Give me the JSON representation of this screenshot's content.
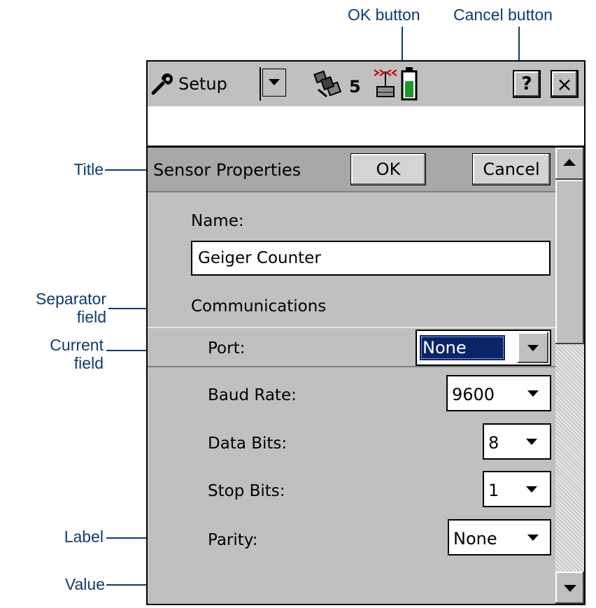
{
  "callouts": {
    "ok_button": "OK button",
    "cancel_button": "Cancel button",
    "title": "Title",
    "separator_field": [
      "Separator",
      "field"
    ],
    "current_field": [
      "Current",
      "field"
    ],
    "label": "Label",
    "value": "Value"
  },
  "topbar": {
    "menu_label": "Setup",
    "satellite_count": "5",
    "help_label": "?",
    "close_label": "×",
    "icons": [
      "wrench-icon",
      "satellite-icon",
      "antenna-icon",
      "battery-icon"
    ]
  },
  "form": {
    "title": "Sensor Properties",
    "ok_label": "OK",
    "cancel_label": "Cancel",
    "name_label": "Name:",
    "name_value": "Geiger Counter",
    "separator": "Communications",
    "fields": {
      "port": {
        "label": "Port:",
        "value": "None"
      },
      "baud_rate": {
        "label": "Baud Rate:",
        "value": "9600"
      },
      "data_bits": {
        "label": "Data Bits:",
        "value": "8"
      },
      "stop_bits": {
        "label": "Stop Bits:",
        "value": "1"
      },
      "parity": {
        "label": "Parity:",
        "value": "None"
      }
    }
  },
  "colors": {
    "callout": "#0d3d6b",
    "selection": "#0a246a",
    "battery": "#1a9a2a",
    "panel": "#c0c0c0"
  }
}
